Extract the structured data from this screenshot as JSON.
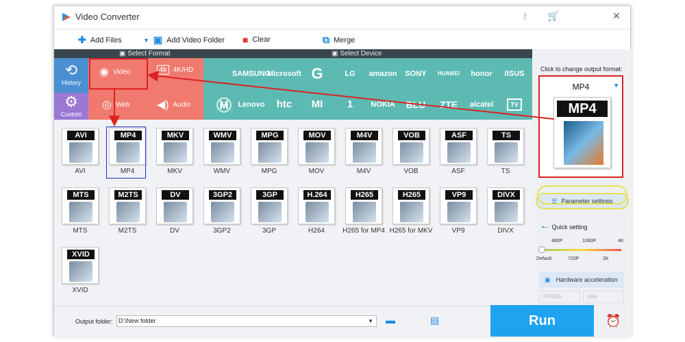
{
  "window": {
    "title": "Video Converter"
  },
  "toolbar": {
    "add_files": "Add Files",
    "add_video_folder": "Add Video Folder",
    "clear": "Clear",
    "merge": "Merge"
  },
  "sections": {
    "select_format": "Select Format",
    "select_device": "Select Device"
  },
  "side": {
    "history": "History",
    "custom": "Custom"
  },
  "format_tabs": {
    "video": "Video",
    "4k": "4K/HD",
    "web": "Web",
    "audio": "Audio"
  },
  "brands_row1": [
    "",
    "SAMSUNG",
    "Microsoft",
    "G",
    "LG",
    "amazon",
    "SONY",
    "HUAWEI",
    "honor",
    "/ISUS"
  ],
  "brands_row2": [
    "",
    "Lenovo",
    "htc",
    "MI",
    "1",
    "NOKIA",
    "BLU",
    "ZTE",
    "alcatel",
    "TV"
  ],
  "formats": [
    {
      "badge": "AVI",
      "label": "AVI"
    },
    {
      "badge": "MP4",
      "label": "MP4"
    },
    {
      "badge": "MKV",
      "label": "MKV"
    },
    {
      "badge": "WMV",
      "label": "WMV"
    },
    {
      "badge": "MPG",
      "label": "MPG"
    },
    {
      "badge": "MOV",
      "label": "MOV"
    },
    {
      "badge": "M4V",
      "label": "M4V"
    },
    {
      "badge": "VOB",
      "label": "VOB"
    },
    {
      "badge": "ASF",
      "label": "ASF"
    },
    {
      "badge": "TS",
      "label": "TS"
    },
    {
      "badge": "MTS",
      "label": "MTS"
    },
    {
      "badge": "M2TS",
      "label": "M2TS"
    },
    {
      "badge": "DV",
      "label": "DV"
    },
    {
      "badge": "3GP2",
      "label": "3GP2"
    },
    {
      "badge": "3GP",
      "label": "3GP"
    },
    {
      "badge": "H.264",
      "label": "H264"
    },
    {
      "badge": "H265",
      "label": "H265 for MP4"
    },
    {
      "badge": "H265",
      "label": "H265 for MKV"
    },
    {
      "badge": "VP9",
      "label": "VP9"
    },
    {
      "badge": "DIVX",
      "label": "DIVX"
    },
    {
      "badge": "XVID",
      "label": "XVID"
    }
  ],
  "right": {
    "click_to_change": "Click to change output format:",
    "output_format": "MP4",
    "output_badge": "MP4",
    "parameter_settings": "Parameter settings",
    "quick_setting": "Quick setting",
    "quality_top": [
      "480P",
      "1080P",
      "4K"
    ],
    "quality_bottom": [
      "Default",
      "720P",
      "2K"
    ],
    "hardware_acceleration": "Hardware acceleration",
    "nvidia": "NVIDIA",
    "intel": "Intel"
  },
  "bottom": {
    "output_folder_label": "Output folder:",
    "output_folder_value": "D:\\New folder",
    "run": "Run"
  },
  "colors": {
    "accent": "#1fa2f0",
    "red_area": "#f07a6f",
    "device_area": "#5dbab3",
    "dark_panel": "#3a464e",
    "annotation": "#dd2222"
  }
}
